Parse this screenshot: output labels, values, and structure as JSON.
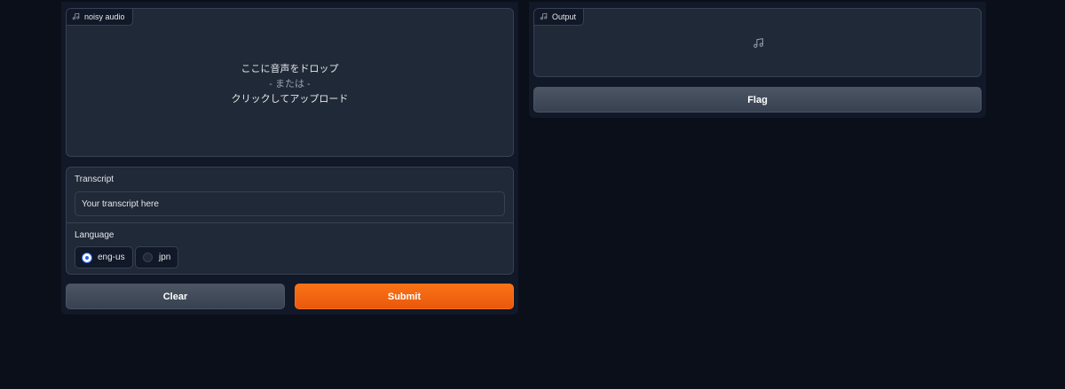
{
  "left": {
    "audio_input": {
      "label": "noisy audio",
      "icon": "music-note-icon",
      "drop_text": "ここに音声をドロップ",
      "or_text": "- または -",
      "upload_text": "クリックしてアップロード"
    },
    "transcript": {
      "label": "Transcript",
      "value": "Your transcript here"
    },
    "language": {
      "label": "Language",
      "options": [
        {
          "label": "eng-us",
          "selected": true
        },
        {
          "label": "jpn",
          "selected": false
        }
      ]
    },
    "buttons": {
      "clear_label": "Clear",
      "submit_label": "Submit"
    }
  },
  "right": {
    "output": {
      "label": "Output",
      "icon": "music-note-icon"
    },
    "flag_label": "Flag"
  },
  "colors": {
    "background": "#0b0f19",
    "panel": "#1f2937",
    "border": "#374151",
    "accent": "#f97316",
    "radio": "#2563eb"
  }
}
